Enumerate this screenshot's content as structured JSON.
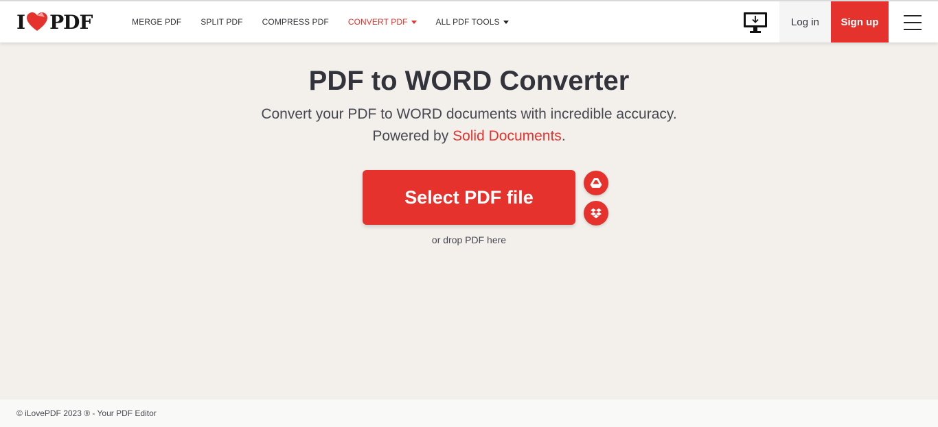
{
  "header": {
    "logo": {
      "left": "I",
      "right": "PDF"
    },
    "nav": [
      {
        "label": "MERGE PDF",
        "active": false,
        "dropdown": false
      },
      {
        "label": "SPLIT PDF",
        "active": false,
        "dropdown": false
      },
      {
        "label": "COMPRESS PDF",
        "active": false,
        "dropdown": false
      },
      {
        "label": "CONVERT PDF",
        "active": true,
        "dropdown": true
      },
      {
        "label": "ALL PDF TOOLS",
        "active": false,
        "dropdown": true
      }
    ],
    "desktop_icon": "desktop-download-icon",
    "login_label": "Log in",
    "signup_label": "Sign up",
    "menu_icon": "hamburger-menu-icon"
  },
  "main": {
    "title": "PDF to WORD Converter",
    "subtitle_line1": "Convert your PDF to WORD documents with incredible accuracy.",
    "subtitle_powered": "Powered by ",
    "subtitle_link": "Solid Documents",
    "subtitle_end": ".",
    "select_button": "Select PDF file",
    "drop_hint": "or drop PDF here",
    "cloud_icons": [
      "google-drive-icon",
      "dropbox-icon"
    ]
  },
  "footer": {
    "text": "© iLovePDF 2023 ® - Your PDF Editor"
  },
  "colors": {
    "accent": "#e5322d",
    "background": "#f3f0ec",
    "text": "#33333b"
  }
}
